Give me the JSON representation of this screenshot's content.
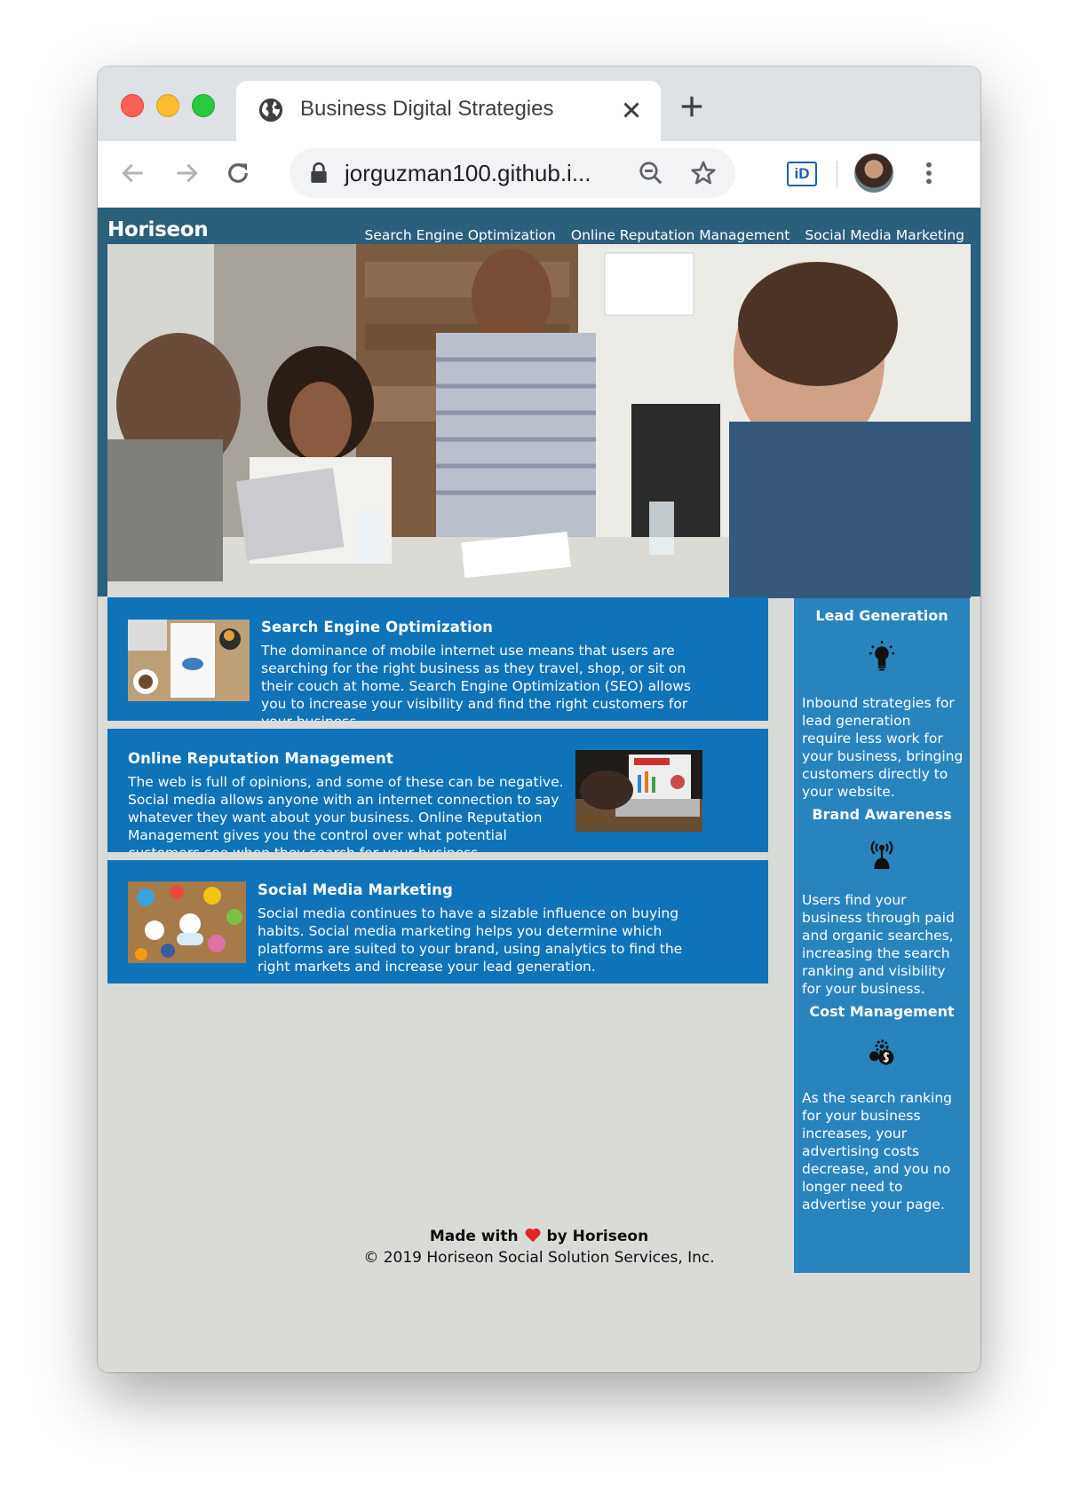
{
  "browser": {
    "tab_title": "Business Digital Strategies",
    "url": "jorguzman100.github.i...",
    "extension_label": "iD"
  },
  "site": {
    "logo": "Horiseon",
    "nav": [
      {
        "label": "Search Engine Optimization"
      },
      {
        "label": "Online Reputation Management"
      },
      {
        "label": "Social Media Marketing"
      }
    ],
    "sections": [
      {
        "title": "Search Engine Optimization",
        "text": "The dominance of mobile internet use means that users are searching for the right business as they travel, shop, or sit on their couch at home. Search Engine Optimization (SEO) allows you to increase your visibility and find the right customers for your business."
      },
      {
        "title": "Online Reputation Management",
        "text": "The web is full of opinions, and some of these can be negative. Social media allows anyone with an internet connection to say whatever they want about your business. Online Reputation Management gives you the control over what potential customers see when they search for your business."
      },
      {
        "title": "Social Media Marketing",
        "text": "Social media continues to have a sizable influence on buying habits. Social media marketing helps you determine which platforms are suited to your brand, using analytics to find the right markets and increase your lead generation."
      }
    ],
    "benefits": [
      {
        "title": "Lead Generation",
        "icon": "lightbulb-icon",
        "text": "Inbound strategies for lead generation require less work for your business, bringing customers directly to your website."
      },
      {
        "title": "Brand Awareness",
        "icon": "broadcast-icon",
        "text": "Users find your business through paid and organic searches, increasing the search ranking and visibility for your business."
      },
      {
        "title": "Cost Management",
        "icon": "gear-dollar-icon",
        "text": "As the search ranking for your business increases, your advertising costs decrease, and you no longer need to advertise your page."
      }
    ],
    "footer": {
      "made_prefix": "Made with",
      "made_suffix": "by Horiseon",
      "copyright": "© 2019 Horiseon Social Solution Services, Inc."
    }
  },
  "colors": {
    "header_bg": "#2a607c",
    "card_bg": "#0e73b9",
    "aside_bg": "#2984be",
    "page_bg": "#d9dbd7"
  }
}
